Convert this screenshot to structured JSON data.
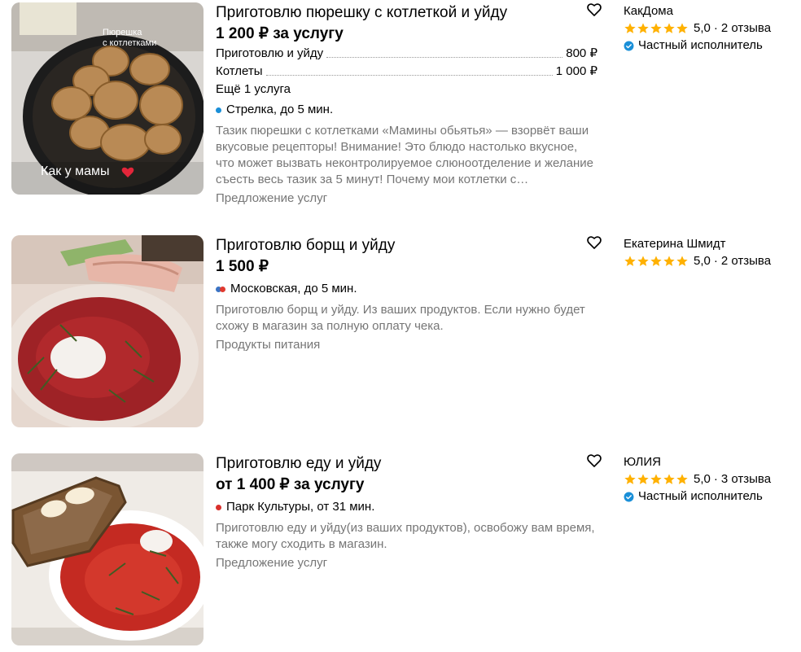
{
  "listings": [
    {
      "photo_caption": "Как у мамы",
      "photo_overlay": [
        "Пюрешка",
        "с котлетками"
      ],
      "title": "Приготовлю пюрешку с котлеткой и уйду",
      "price": "1 200 ₽ за услугу",
      "services": [
        {
          "name": "Приготовлю и уйду",
          "price": "800 ₽"
        },
        {
          "name": "Котлеты",
          "price": "1 000 ₽"
        }
      ],
      "more_services": "Ещё 1 услуга",
      "metro": {
        "station": "Стрелка, до 5 мин.",
        "colors": [
          "#1a8fd8"
        ]
      },
      "description": "Тазик пюрешки с котлетками «Мамины обьятья» — взорвёт ваши вкусовые рецепторы! Внимание! Это блюдо настолько вкусное, что может вызвать неконтролируемое слюноотделение и желание съесть весь тазик за 5 минут! Почему мои котлетки с…",
      "category": "Предложение услуг",
      "seller": {
        "name": "КакДома",
        "rating": "5,0",
        "separator": "·",
        "reviews": "2 отзыва",
        "badge": "Частный исполнитель"
      }
    },
    {
      "title": "Приготовлю борщ и уйду",
      "price": "1 500 ₽",
      "metro": {
        "station": "Московская, до 5 мин.",
        "colors": [
          "#3b74c4",
          "#e03a2f"
        ]
      },
      "description": "Приготовлю борщ и уйду. Из ваших продуктов. Если нужно будет схожу в магазин за полную оплату чека.",
      "category": "Продукты питания",
      "seller": {
        "name": "Екатерина Шмидт",
        "rating": "5,0",
        "separator": "·",
        "reviews": "2 отзыва"
      }
    },
    {
      "title": "Приготовлю еду и уйду",
      "price": "от 1 400 ₽ за услугу",
      "metro": {
        "station": "Парк Культуры, от 31 мин.",
        "colors": [
          "#d9302c"
        ]
      },
      "description": "Приготовлю еду и уйду(из ваших продуктов), освобожу вам время, также могу сходить в магазин.",
      "category": "Предложение услуг",
      "seller": {
        "name": "ЮЛИЯ",
        "rating": "5,0",
        "separator": "·",
        "reviews": "3 отзыва",
        "badge": "Частный исполнитель"
      }
    }
  ],
  "colors": {
    "star": "#ffb100",
    "verified": "#1a8fd8",
    "muted": "#767676"
  },
  "icons": {
    "favorite": "heart-outline-icon",
    "verified": "verified-check-icon",
    "rating": "star-icon"
  }
}
